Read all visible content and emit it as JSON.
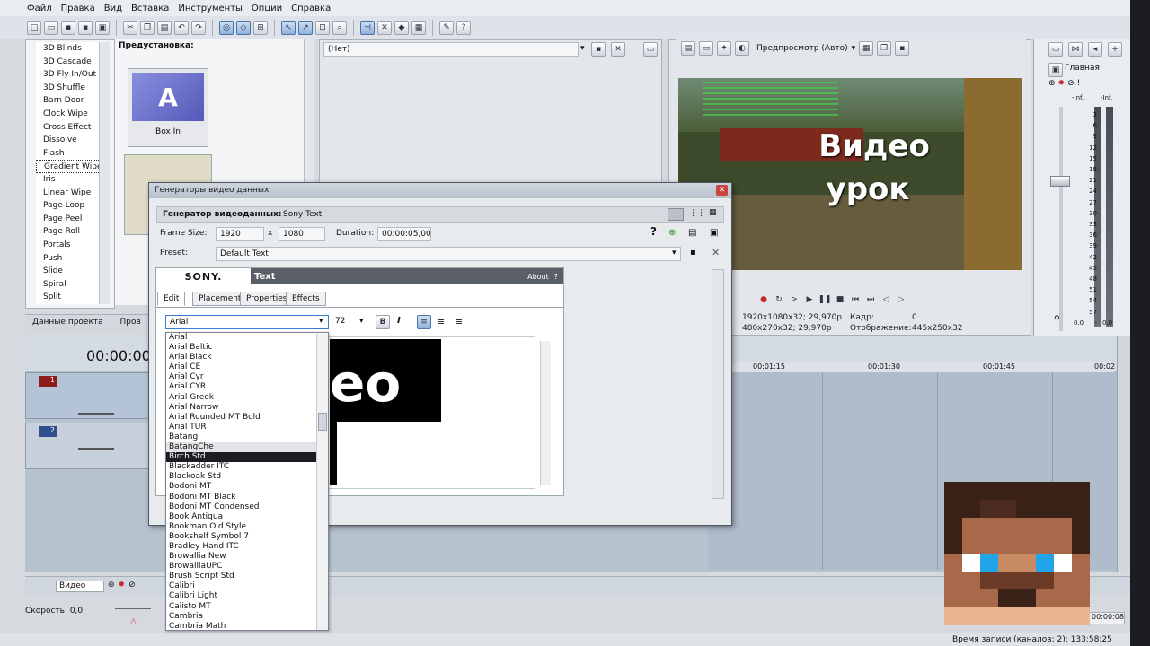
{
  "menu": [
    "Файл",
    "Правка",
    "Вид",
    "Вставка",
    "Инструменты",
    "Опции",
    "Справка"
  ],
  "transitions": [
    "3D Blinds",
    "3D Cascade",
    "3D Fly In/Out",
    "3D Shuffle",
    "Barn Door",
    "Clock Wipe",
    "Cross Effect",
    "Dissolve",
    "Flash",
    "Gradient Wipe",
    "Iris",
    "Linear Wipe",
    "Page Loop",
    "Page Peel",
    "Page Roll",
    "Portals",
    "Push",
    "Slide",
    "Spiral",
    "Split"
  ],
  "transitions_selected": "Gradient Wipe",
  "presets": {
    "label": "Предустановка:",
    "item1": "Box In"
  },
  "bottom_tabs": [
    "Данные проекта",
    "Пров"
  ],
  "fx_panel": {
    "preset_value": "(Нет)"
  },
  "timecode": "00:00:00",
  "tracks": [
    {
      "num": "1"
    },
    {
      "num": "2"
    }
  ],
  "ruler": [
    "00:01:15",
    "00:01:30",
    "00:01:45",
    "00:02"
  ],
  "preview": {
    "mode": "Предпросмотр (Авто)",
    "overlay_line1": "Видео",
    "overlay_line2": "урок",
    "proj_info": "1920x1080x32; 29,970p",
    "prev_info": "480x270x32; 29,970p",
    "frame_label": "Кадр:",
    "frame_value": "0",
    "display_label": "Отображение:",
    "display_value": "445x250x32"
  },
  "mixer": {
    "title": "Главная",
    "inf_left": "-Inf.",
    "inf_right": "-Inf.",
    "scale": [
      "3",
      "6",
      "9",
      "12",
      "15",
      "18",
      "21",
      "24",
      "27",
      "30",
      "33",
      "36",
      "39",
      "42",
      "45",
      "48",
      "51",
      "54",
      "57",
      "-"
    ],
    "val_left": "0.0",
    "val_right": "0.0"
  },
  "dialog": {
    "title": "Генераторы видео данных",
    "generator_label": "Генератор видеоданных:",
    "generator_value": "Sony Text",
    "frame_size_label": "Frame Size:",
    "width": "1920",
    "x": "x",
    "height": "1080",
    "duration_label": "Duration:",
    "duration_value": "00:00:05,00",
    "preset_label": "Preset:",
    "preset_value": "Default Text"
  },
  "sony_text": {
    "logo": "SONY.",
    "title": "Text",
    "about": "About",
    "about_q": "?",
    "tabs": [
      "Edit",
      "Placement",
      "Properties",
      "Effects"
    ],
    "font": "Arial",
    "size": "72",
    "bold": "B",
    "italic": "I",
    "preview_text": "eo"
  },
  "font_list": [
    "Arial",
    "Arial Baltic",
    "Arial Black",
    "Arial CE",
    "Arial Cyr",
    "Arial CYR",
    "Arial Greek",
    "Arial Narrow",
    "Arial Rounded MT Bold",
    "Arial TUR",
    "Batang",
    "BatangChe",
    "Birch Std",
    "Blackadder ITC",
    "Blackoak Std",
    "Bodoni MT",
    "Bodoni MT Black",
    "Bodoni MT Condensed",
    "Book Antiqua",
    "Bookman Old Style",
    "Bookshelf Symbol 7",
    "Bradley Hand ITC",
    "Browallia New",
    "BrowalliaUPC",
    "Brush Script Std",
    "Calibri",
    "Calibri Light",
    "Calisto MT",
    "Cambria",
    "Cambria Math"
  ],
  "font_list_highlight": "Birch Std",
  "bus": {
    "label": "Видео"
  },
  "speed": "Скорость: 0,0",
  "status": "Время записи (каналов: 2): 133:58:25",
  "time_right": "00:00:08"
}
